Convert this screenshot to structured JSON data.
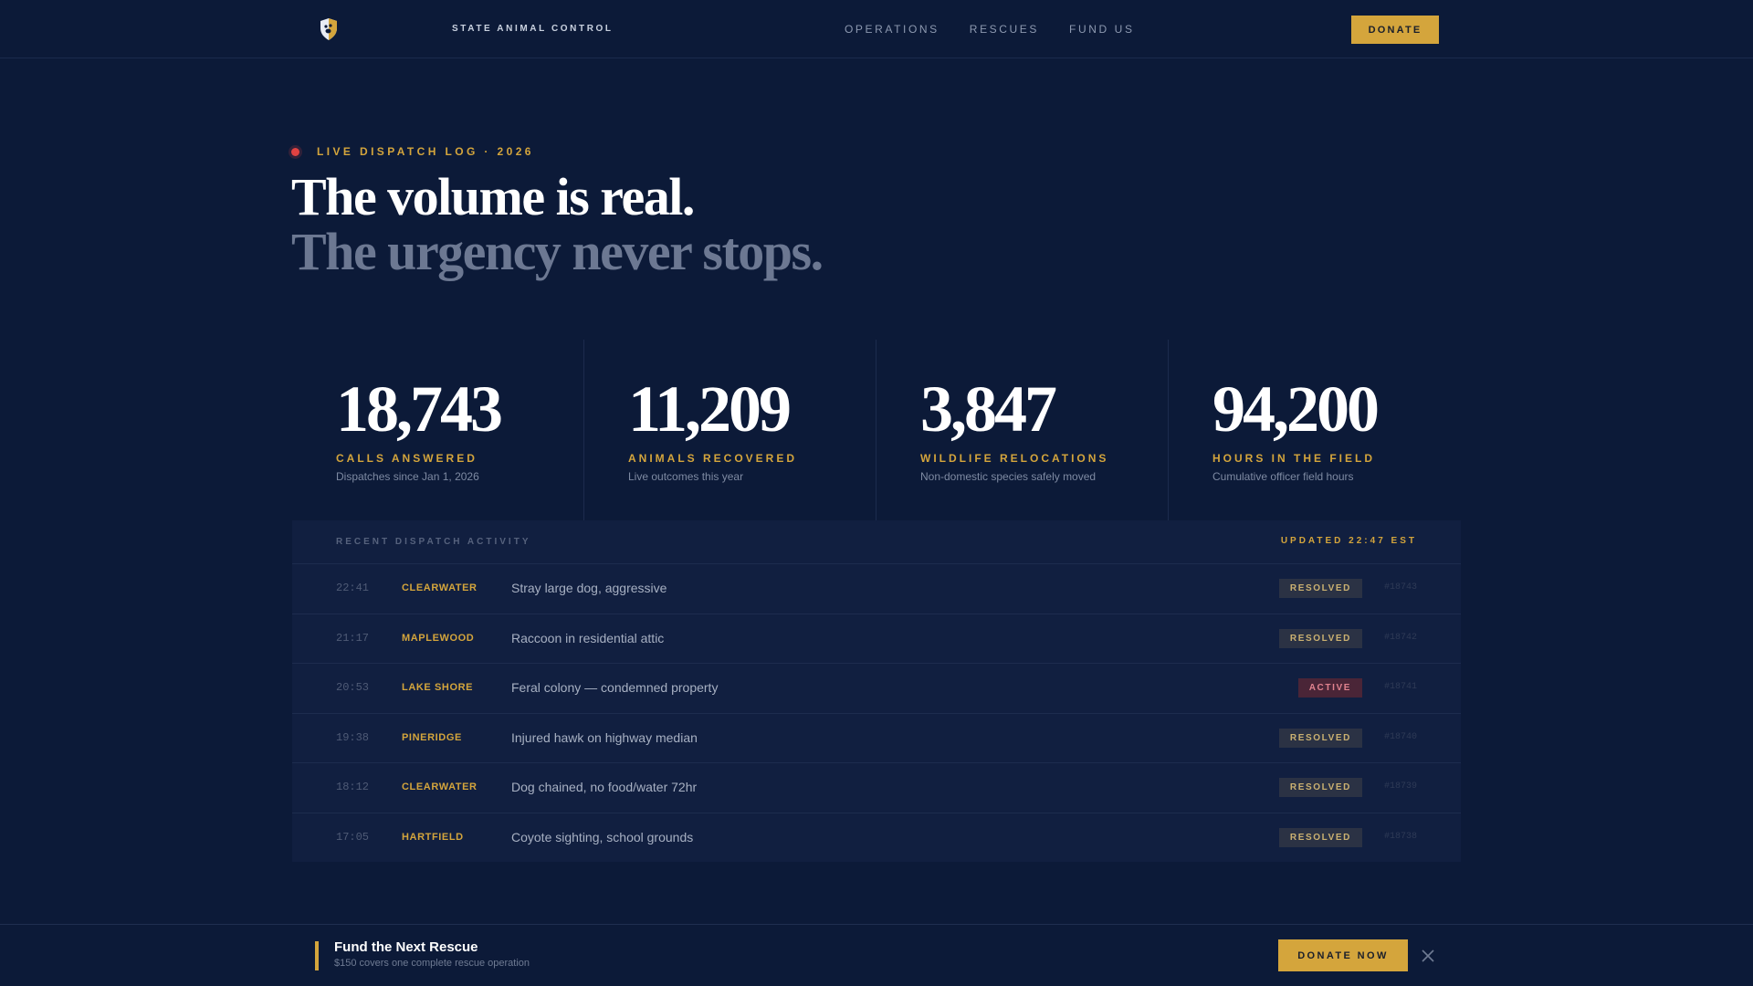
{
  "nav": {
    "brand": "STATE ANIMAL CONTROL",
    "links": [
      "OPERATIONS",
      "RESCUES",
      "FUND US"
    ],
    "donate_label": "DONATE",
    "logo_icon": "shield-paw-icon"
  },
  "hero": {
    "eyebrow": "LIVE DISPATCH LOG · 2026",
    "headline_line1": "The volume is real.",
    "headline_line2": "The urgency never stops."
  },
  "stats": [
    {
      "value": "18,743",
      "label": "CALLS ANSWERED",
      "sub": "Dispatches since Jan 1, 2026"
    },
    {
      "value": "11,209",
      "label": "ANIMALS RECOVERED",
      "sub": "Live outcomes this year"
    },
    {
      "value": "3,847",
      "label": "WILDLIFE RELOCATIONS",
      "sub": "Non-domestic species safely moved"
    },
    {
      "value": "94,200",
      "label": "HOURS IN THE FIELD",
      "sub": "Cumulative officer field hours"
    }
  ],
  "dispatch": {
    "title": "RECENT DISPATCH ACTIVITY",
    "updated": "UPDATED 22:47 EST",
    "rows": [
      {
        "time": "22:41",
        "location": "CLEARWATER",
        "description": "Stray large dog, aggressive",
        "status": "RESOLVED",
        "id": "#18743"
      },
      {
        "time": "21:17",
        "location": "MAPLEWOOD",
        "description": "Raccoon in residential attic",
        "status": "RESOLVED",
        "id": "#18742"
      },
      {
        "time": "20:53",
        "location": "LAKE SHORE",
        "description": "Feral colony — condemned property",
        "status": "ACTIVE",
        "id": "#18741"
      },
      {
        "time": "19:38",
        "location": "PINERIDGE",
        "description": "Injured hawk on highway median",
        "status": "RESOLVED",
        "id": "#18740"
      },
      {
        "time": "18:12",
        "location": "CLEARWATER",
        "description": "Dog chained, no food/water 72hr",
        "status": "RESOLVED",
        "id": "#18739"
      },
      {
        "time": "17:05",
        "location": "HARTFIELD",
        "description": "Coyote sighting, school grounds",
        "status": "RESOLVED",
        "id": "#18738"
      }
    ]
  },
  "banner": {
    "title": "Fund the Next Rescue",
    "subtitle": "$150 covers one complete rescue operation",
    "cta": "DONATE NOW",
    "close_icon": "close-icon"
  },
  "colors": {
    "background": "#0c1a38",
    "accent": "#d4a53c",
    "live_dot": "#e14242",
    "active_badge": "#4a2537"
  }
}
